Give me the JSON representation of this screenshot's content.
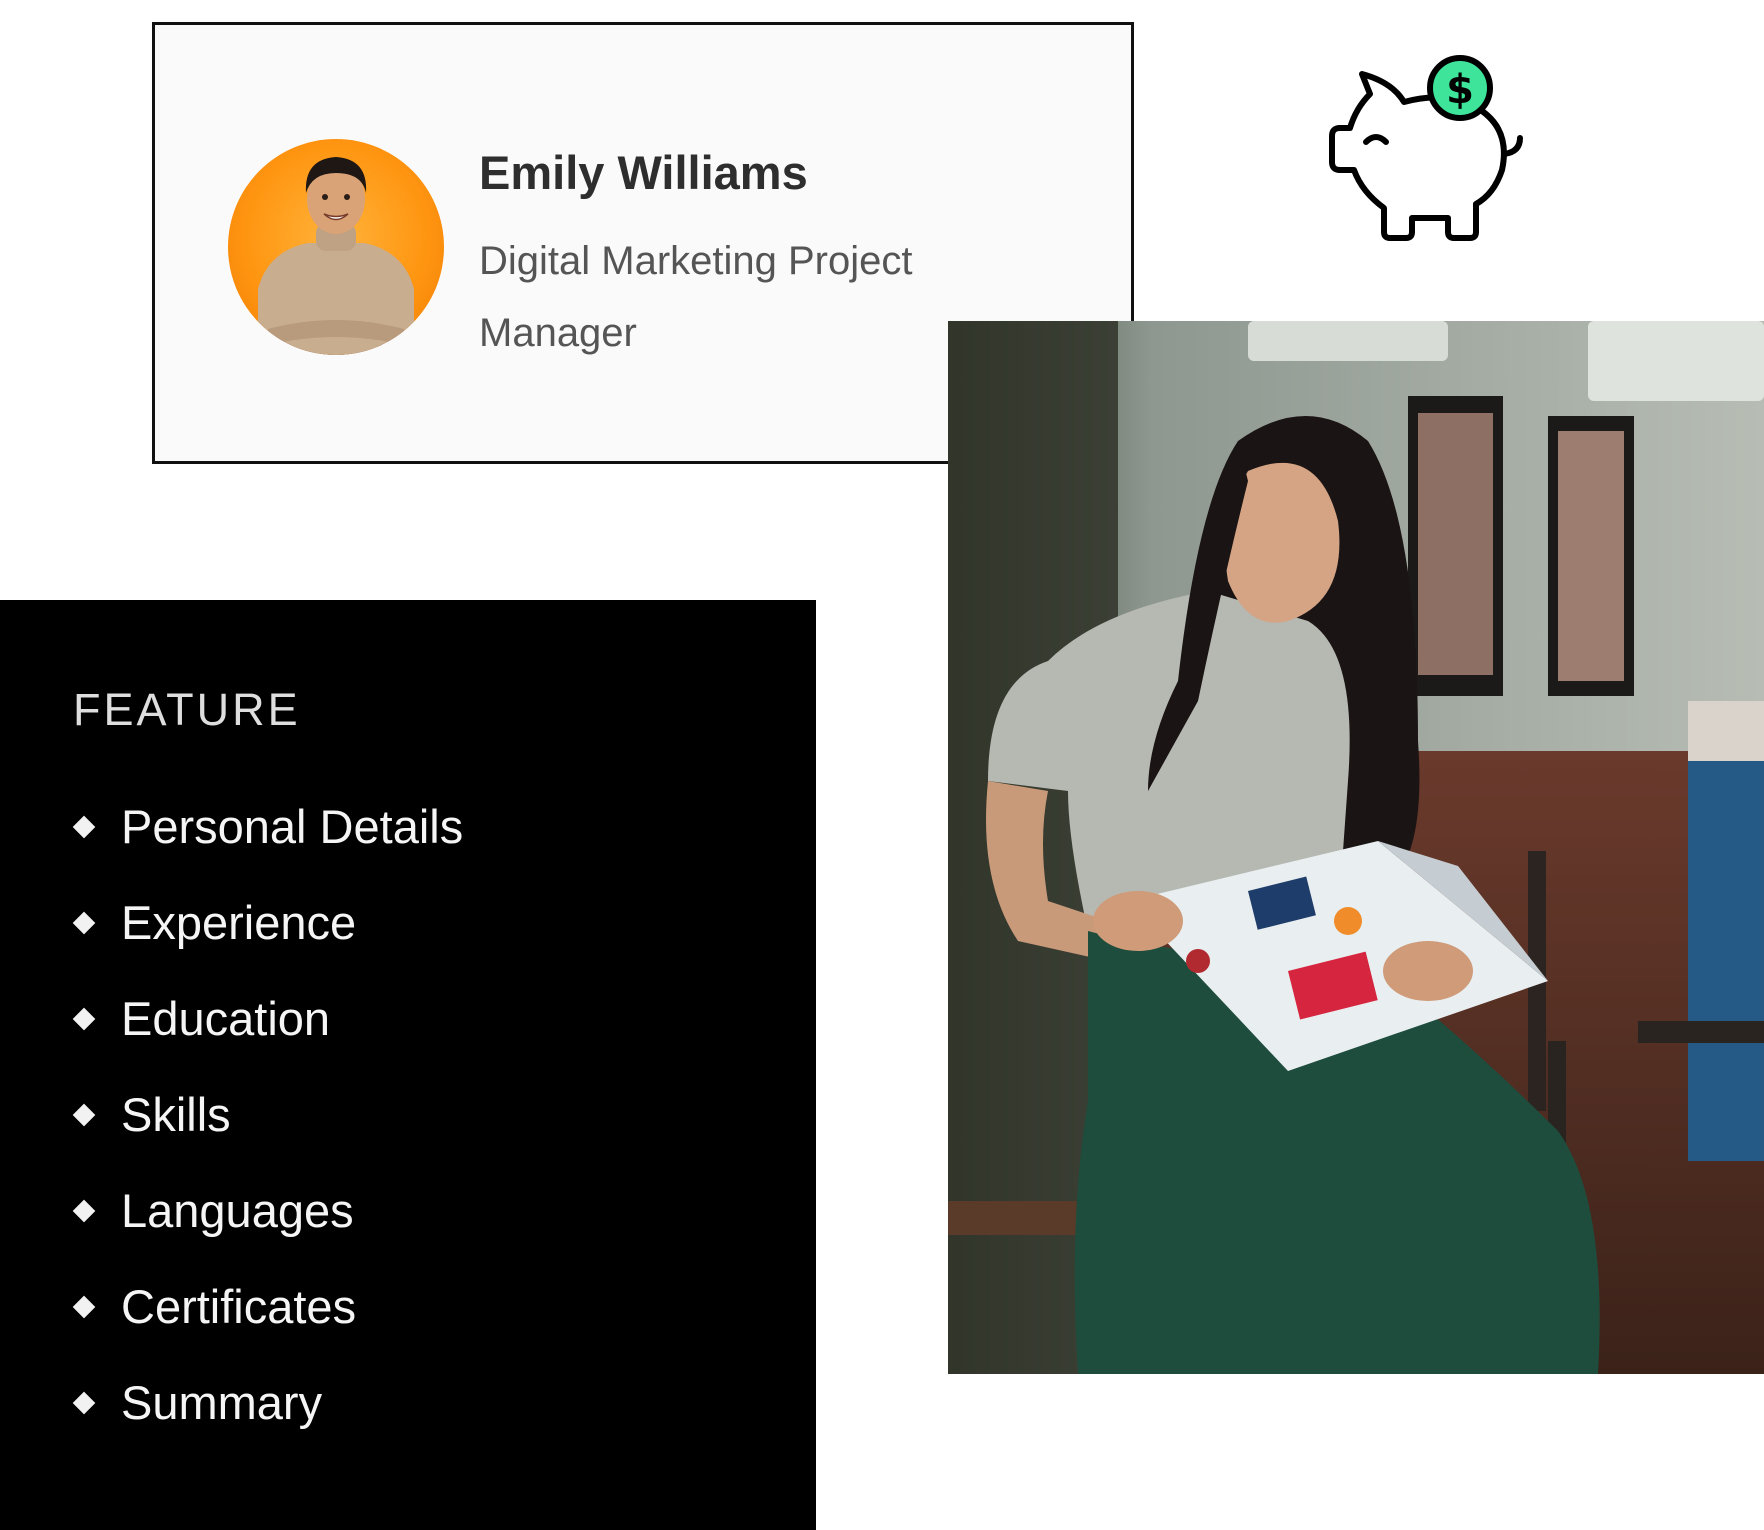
{
  "profile": {
    "name": "Emily Williams",
    "role": "Digital Marketing Project Manager"
  },
  "feature": {
    "title": "FEATURE",
    "items": [
      {
        "label": "Personal Details"
      },
      {
        "label": "Experience"
      },
      {
        "label": "Education"
      },
      {
        "label": "Skills"
      },
      {
        "label": "Languages"
      },
      {
        "label": "Certificates"
      },
      {
        "label": "Summary"
      }
    ]
  },
  "icons": {
    "piggy": "piggy-bank-icon",
    "coin": "dollar-coin-icon"
  },
  "colors": {
    "avatar_bg": "#ff9612",
    "coin": "#3ee49a",
    "panel_bg": "#000000",
    "card_bg": "#fafafa"
  }
}
